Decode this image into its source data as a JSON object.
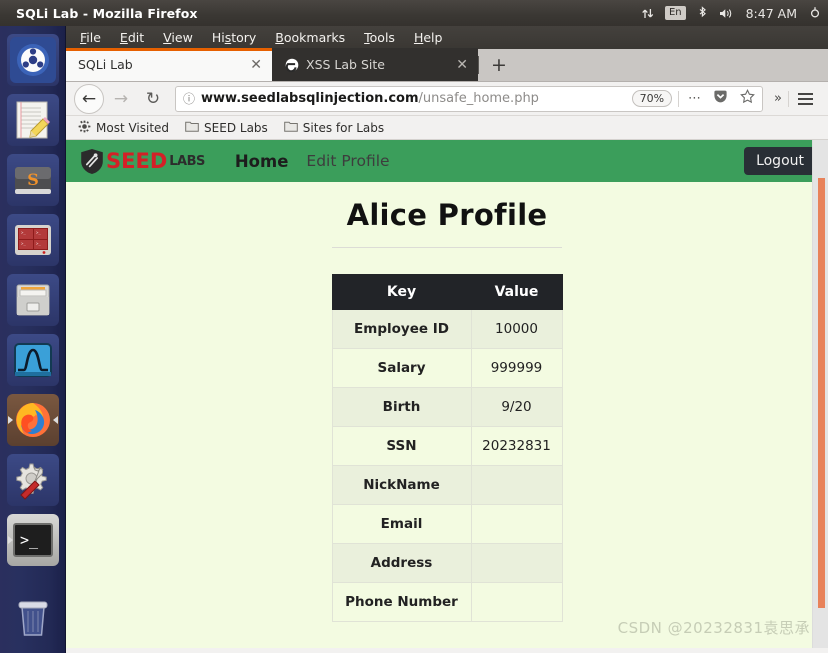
{
  "os": {
    "panel_title": "SQLi Lab - Mozilla Firefox",
    "tray": {
      "network_icon": "network-updown-icon",
      "keyboard_layout": "En",
      "bluetooth_icon": "bluetooth-icon",
      "volume_icon": "volume-icon",
      "clock": "8:47 AM",
      "power_icon": "power-gear-icon"
    },
    "launcher": {
      "items": [
        {
          "name": "ubuntu-dash-icon",
          "label": "Dash Home"
        },
        {
          "name": "text-editor-icon",
          "label": "Text Editor"
        },
        {
          "name": "sublime-text-icon",
          "label": "Sublime Text"
        },
        {
          "name": "terminal-red-icon",
          "label": "Terminal Grid"
        },
        {
          "name": "file-manager-icon",
          "label": "Files"
        },
        {
          "name": "wireshark-icon",
          "label": "Wireshark"
        },
        {
          "name": "firefox-icon",
          "label": "Firefox"
        },
        {
          "name": "settings-tools-icon",
          "label": "System Settings"
        },
        {
          "name": "terminal-icon",
          "label": "Terminal"
        },
        {
          "name": "trash-icon",
          "label": "Trash"
        }
      ]
    }
  },
  "browser": {
    "menu": [
      {
        "label": "File",
        "accel": "F"
      },
      {
        "label": "Edit",
        "accel": "E"
      },
      {
        "label": "View",
        "accel": "V"
      },
      {
        "label": "History",
        "accel": "s"
      },
      {
        "label": "Bookmarks",
        "accel": "B"
      },
      {
        "label": "Tools",
        "accel": "T"
      },
      {
        "label": "Help",
        "accel": "H"
      }
    ],
    "tabs": [
      {
        "label": "SQLi Lab",
        "active": true,
        "favicon": "none",
        "close": "✕"
      },
      {
        "label": "XSS Lab Site",
        "active": false,
        "favicon": "elgg-icon",
        "close": "✕"
      }
    ],
    "new_tab_label": "+",
    "toolbar": {
      "back_icon": "back-arrow-icon",
      "forward_icon": "forward-arrow-icon",
      "reload_icon": "reload-icon",
      "identity_icon": "info-circle-icon",
      "url_prefix": "www.seedlabsqlinjection.com",
      "url_path": "/unsafe_home.php",
      "url_full": "www.seedlabsqlinjection.com/unsafe_home.php",
      "zoom_level": "70%",
      "page_actions_icon": "ellipsis-icon",
      "pocket_icon": "pocket-icon",
      "bookmark_star_icon": "star-icon",
      "overflow_icon": "double-chevron-icon",
      "menu_icon": "hamburger-icon"
    },
    "bookmarks": [
      {
        "label": "Most Visited",
        "icon": "star-burst-icon"
      },
      {
        "label": "SEED Labs",
        "icon": "folder-icon"
      },
      {
        "label": "Sites for Labs",
        "icon": "folder-icon"
      }
    ]
  },
  "page": {
    "brand": {
      "shield_icon": "seed-shield-icon",
      "seed": "SEED",
      "labs": "LABS"
    },
    "nav_links": [
      {
        "label": "Home",
        "active": true
      },
      {
        "label": "Edit Profile",
        "active": false
      }
    ],
    "logout_label": "Logout",
    "title": "Alice Profile",
    "table": {
      "headers": [
        "Key",
        "Value"
      ],
      "rows": [
        {
          "key": "Employee ID",
          "value": "10000"
        },
        {
          "key": "Salary",
          "value": "999999"
        },
        {
          "key": "Birth",
          "value": "9/20"
        },
        {
          "key": "SSN",
          "value": "20232831"
        },
        {
          "key": "NickName",
          "value": ""
        },
        {
          "key": "Email",
          "value": ""
        },
        {
          "key": "Address",
          "value": ""
        },
        {
          "key": "Phone Number",
          "value": ""
        }
      ]
    },
    "watermark": "CSDN @20232831袁思承"
  },
  "colors": {
    "seed_nav_green": "#3b9e5b",
    "page_bg": "#f3fbe1",
    "table_header_bg": "#222428",
    "table_row_alt_bg": "#eaf0dc",
    "logout_bg": "#292f36",
    "brand_red": "#d42027",
    "tab_accent": "#e66000",
    "scrollbar_thumb": "#e8825a"
  }
}
